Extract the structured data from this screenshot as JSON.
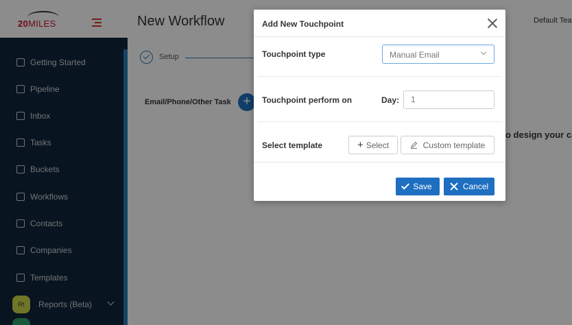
{
  "header": {
    "logo_text": "20",
    "logo_text_rest": "MILES",
    "page_title": "New Workflow",
    "team_label": "Default Tea"
  },
  "sidebar": {
    "items": [
      {
        "label": "Getting Started",
        "icon": "rocket-icon"
      },
      {
        "label": "Pipeline",
        "icon": "pipeline-icon"
      },
      {
        "label": "Inbox",
        "icon": "inbox-icon"
      },
      {
        "label": "Tasks",
        "icon": "tasks-icon"
      },
      {
        "label": "Buckets",
        "icon": "bucket-icon"
      },
      {
        "label": "Workflows",
        "icon": "chart-icon"
      },
      {
        "label": "Contacts",
        "icon": "contacts-icon"
      },
      {
        "label": "Companies",
        "icon": "companies-icon"
      },
      {
        "label": "Templates",
        "icon": "templates-icon"
      }
    ],
    "reports": {
      "badge": "Rt",
      "label": "Reports (Beta)"
    }
  },
  "main": {
    "step_label": "Setup",
    "task_label": "Email/Phone/Other Task",
    "add_symbol": "+",
    "design_text": "o design your ca"
  },
  "modal": {
    "title": "Add New Touchpoint",
    "touchpoint_type_label": "Touchpoint type",
    "touchpoint_type_value": "Manual Email",
    "perform_on_label": "Touchpoint perform on",
    "day_label": "Day:",
    "day_value": "1",
    "template_label": "Select template",
    "select_button": "Select",
    "select_plus": "+",
    "custom_template_button": "Custom template",
    "save_button": "Save",
    "cancel_button": "Cancel"
  },
  "colors": {
    "primary": "#1f6fc0",
    "sidebar": "#10263a",
    "brand_red": "#c8102e"
  }
}
